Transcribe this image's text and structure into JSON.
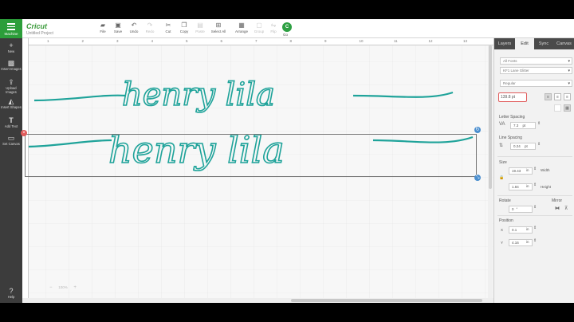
{
  "app": {
    "menu_label": "Machine",
    "logo": "Cricut",
    "project_name": "Untitled Project"
  },
  "toolbar": {
    "items": [
      {
        "label": "File",
        "icon": "folder-icon"
      },
      {
        "label": "Save",
        "icon": "save-icon"
      },
      {
        "label": "Undo",
        "icon": "undo-icon"
      },
      {
        "label": "Redo",
        "icon": "redo-icon"
      },
      {
        "label": "Cut",
        "icon": "cut-icon"
      },
      {
        "label": "Copy",
        "icon": "copy-icon"
      },
      {
        "label": "Paste",
        "icon": "paste-icon"
      },
      {
        "label": "Select All",
        "icon": "select-all-icon"
      },
      {
        "label": "Arrange",
        "icon": "arrange-icon"
      },
      {
        "label": "Group",
        "icon": "group-icon"
      },
      {
        "label": "Flip",
        "icon": "flip-icon"
      }
    ],
    "go_label": "Go",
    "go_icon_text": "C"
  },
  "sidebar": {
    "items": [
      {
        "label": "New",
        "icon": "plus-icon"
      },
      {
        "label": "Insert Images",
        "icon": "image-icon"
      },
      {
        "label": "Upload Images",
        "icon": "upload-icon"
      },
      {
        "label": "Insert Shapes",
        "icon": "shapes-icon"
      },
      {
        "label": "Add Text",
        "icon": "text-icon"
      },
      {
        "label": "Set Canvas",
        "icon": "canvas-icon"
      },
      {
        "label": "Help",
        "icon": "help-icon"
      }
    ]
  },
  "ruler": {
    "ticks": [
      "1",
      "2",
      "3",
      "4",
      "5",
      "6",
      "7",
      "8",
      "9",
      "10",
      "11",
      "12",
      "13"
    ]
  },
  "canvas": {
    "text_top": "henry lila",
    "text_bottom": "henry lila",
    "zoom_label": "100%"
  },
  "panel": {
    "tabs": [
      "Layers",
      "Edit",
      "Sync",
      "Canvas"
    ],
    "active_tab": "Edit",
    "font_filter": "All Fonts",
    "font_name": "KF1 Lane Glitter",
    "font_style": "Regular",
    "font_size": "139.8 pt",
    "letter_spacing_label": "Letter Spacing",
    "letter_spacing_value": "7.3",
    "letter_spacing_unit": "pt",
    "line_spacing_label": "Line Spacing",
    "line_spacing_value": "0.24",
    "line_spacing_unit": "pt",
    "size_label": "Size",
    "width_value": "19.43",
    "width_unit": "in",
    "width_label": "Width",
    "height_value": "1.84",
    "height_unit": "in",
    "height_label": "Height",
    "rotate_label": "Rotate",
    "rotate_value": "0",
    "mirror_label": "Mirror",
    "position_label": "Position",
    "x_label": "X",
    "x_value": "0.1",
    "x_unit": "in",
    "y_label": "Y",
    "y_value": "4.16",
    "y_unit": "in"
  },
  "colors": {
    "text_teal": "#1fa39a",
    "brand_green": "#2c9e3a",
    "dark_panel": "#3c3c3c",
    "highlight_red": "#e05a5a"
  }
}
